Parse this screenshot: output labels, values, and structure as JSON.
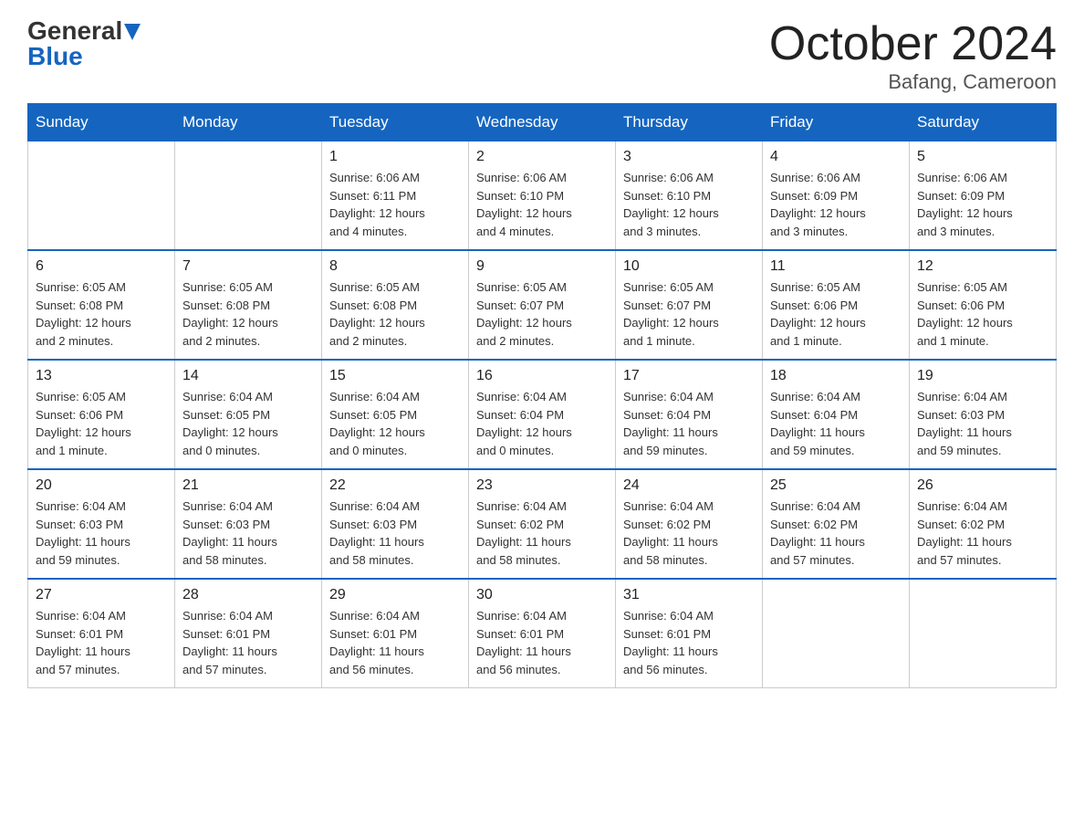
{
  "logo": {
    "general": "General",
    "blue": "Blue"
  },
  "title": "October 2024",
  "location": "Bafang, Cameroon",
  "days_of_week": [
    "Sunday",
    "Monday",
    "Tuesday",
    "Wednesday",
    "Thursday",
    "Friday",
    "Saturday"
  ],
  "weeks": [
    [
      {
        "day": "",
        "info": ""
      },
      {
        "day": "",
        "info": ""
      },
      {
        "day": "1",
        "info": "Sunrise: 6:06 AM\nSunset: 6:11 PM\nDaylight: 12 hours\nand 4 minutes."
      },
      {
        "day": "2",
        "info": "Sunrise: 6:06 AM\nSunset: 6:10 PM\nDaylight: 12 hours\nand 4 minutes."
      },
      {
        "day": "3",
        "info": "Sunrise: 6:06 AM\nSunset: 6:10 PM\nDaylight: 12 hours\nand 3 minutes."
      },
      {
        "day": "4",
        "info": "Sunrise: 6:06 AM\nSunset: 6:09 PM\nDaylight: 12 hours\nand 3 minutes."
      },
      {
        "day": "5",
        "info": "Sunrise: 6:06 AM\nSunset: 6:09 PM\nDaylight: 12 hours\nand 3 minutes."
      }
    ],
    [
      {
        "day": "6",
        "info": "Sunrise: 6:05 AM\nSunset: 6:08 PM\nDaylight: 12 hours\nand 2 minutes."
      },
      {
        "day": "7",
        "info": "Sunrise: 6:05 AM\nSunset: 6:08 PM\nDaylight: 12 hours\nand 2 minutes."
      },
      {
        "day": "8",
        "info": "Sunrise: 6:05 AM\nSunset: 6:08 PM\nDaylight: 12 hours\nand 2 minutes."
      },
      {
        "day": "9",
        "info": "Sunrise: 6:05 AM\nSunset: 6:07 PM\nDaylight: 12 hours\nand 2 minutes."
      },
      {
        "day": "10",
        "info": "Sunrise: 6:05 AM\nSunset: 6:07 PM\nDaylight: 12 hours\nand 1 minute."
      },
      {
        "day": "11",
        "info": "Sunrise: 6:05 AM\nSunset: 6:06 PM\nDaylight: 12 hours\nand 1 minute."
      },
      {
        "day": "12",
        "info": "Sunrise: 6:05 AM\nSunset: 6:06 PM\nDaylight: 12 hours\nand 1 minute."
      }
    ],
    [
      {
        "day": "13",
        "info": "Sunrise: 6:05 AM\nSunset: 6:06 PM\nDaylight: 12 hours\nand 1 minute."
      },
      {
        "day": "14",
        "info": "Sunrise: 6:04 AM\nSunset: 6:05 PM\nDaylight: 12 hours\nand 0 minutes."
      },
      {
        "day": "15",
        "info": "Sunrise: 6:04 AM\nSunset: 6:05 PM\nDaylight: 12 hours\nand 0 minutes."
      },
      {
        "day": "16",
        "info": "Sunrise: 6:04 AM\nSunset: 6:04 PM\nDaylight: 12 hours\nand 0 minutes."
      },
      {
        "day": "17",
        "info": "Sunrise: 6:04 AM\nSunset: 6:04 PM\nDaylight: 11 hours\nand 59 minutes."
      },
      {
        "day": "18",
        "info": "Sunrise: 6:04 AM\nSunset: 6:04 PM\nDaylight: 11 hours\nand 59 minutes."
      },
      {
        "day": "19",
        "info": "Sunrise: 6:04 AM\nSunset: 6:03 PM\nDaylight: 11 hours\nand 59 minutes."
      }
    ],
    [
      {
        "day": "20",
        "info": "Sunrise: 6:04 AM\nSunset: 6:03 PM\nDaylight: 11 hours\nand 59 minutes."
      },
      {
        "day": "21",
        "info": "Sunrise: 6:04 AM\nSunset: 6:03 PM\nDaylight: 11 hours\nand 58 minutes."
      },
      {
        "day": "22",
        "info": "Sunrise: 6:04 AM\nSunset: 6:03 PM\nDaylight: 11 hours\nand 58 minutes."
      },
      {
        "day": "23",
        "info": "Sunrise: 6:04 AM\nSunset: 6:02 PM\nDaylight: 11 hours\nand 58 minutes."
      },
      {
        "day": "24",
        "info": "Sunrise: 6:04 AM\nSunset: 6:02 PM\nDaylight: 11 hours\nand 58 minutes."
      },
      {
        "day": "25",
        "info": "Sunrise: 6:04 AM\nSunset: 6:02 PM\nDaylight: 11 hours\nand 57 minutes."
      },
      {
        "day": "26",
        "info": "Sunrise: 6:04 AM\nSunset: 6:02 PM\nDaylight: 11 hours\nand 57 minutes."
      }
    ],
    [
      {
        "day": "27",
        "info": "Sunrise: 6:04 AM\nSunset: 6:01 PM\nDaylight: 11 hours\nand 57 minutes."
      },
      {
        "day": "28",
        "info": "Sunrise: 6:04 AM\nSunset: 6:01 PM\nDaylight: 11 hours\nand 57 minutes."
      },
      {
        "day": "29",
        "info": "Sunrise: 6:04 AM\nSunset: 6:01 PM\nDaylight: 11 hours\nand 56 minutes."
      },
      {
        "day": "30",
        "info": "Sunrise: 6:04 AM\nSunset: 6:01 PM\nDaylight: 11 hours\nand 56 minutes."
      },
      {
        "day": "31",
        "info": "Sunrise: 6:04 AM\nSunset: 6:01 PM\nDaylight: 11 hours\nand 56 minutes."
      },
      {
        "day": "",
        "info": ""
      },
      {
        "day": "",
        "info": ""
      }
    ]
  ]
}
